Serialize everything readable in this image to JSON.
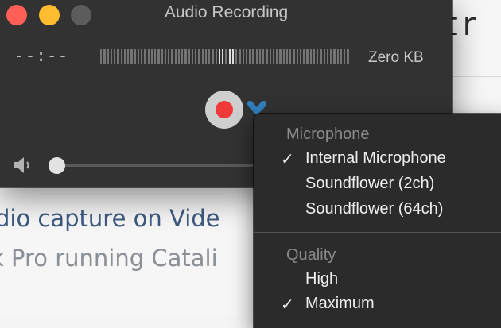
{
  "background": {
    "title_fragment": "tr",
    "line1": "dio capture on Vide",
    "line2": "k Pro running Catali"
  },
  "window": {
    "title": "Audio Recording",
    "elapsed_time": "--:--",
    "file_size": "Zero KB",
    "volume_level": 0.0,
    "colors": {
      "record": "#f03a3a",
      "options": "#2f7fc0",
      "close": "#ff5f57",
      "minimize": "#febc2e"
    }
  },
  "menu": {
    "microphone_header": "Microphone",
    "microphone_items": [
      {
        "label": "Internal Microphone",
        "checked": true,
        "check": "✓"
      },
      {
        "label": "Soundflower (2ch)",
        "checked": false,
        "check": ""
      },
      {
        "label": "Soundflower (64ch)",
        "checked": false,
        "check": ""
      }
    ],
    "quality_header": "Quality",
    "quality_items": [
      {
        "label": "High",
        "checked": false,
        "check": ""
      },
      {
        "label": "Maximum",
        "checked": true,
        "check": "✓"
      }
    ]
  },
  "icons": {
    "record": "record-icon",
    "options": "chevron-down-icon",
    "volume": "speaker-icon"
  }
}
